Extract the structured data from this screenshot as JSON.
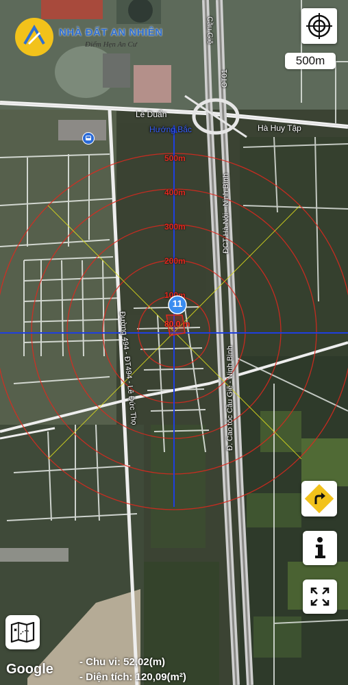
{
  "brand": {
    "title": "NHÀ ĐẤT AN NHIÊN",
    "tagline": "Điểm Hẹn An Cư",
    "accent": "#f2c21b",
    "title_color": "#2f6fd0"
  },
  "scale": {
    "label": "500m"
  },
  "direction": {
    "label": "Hướng Bắc"
  },
  "rings": [
    {
      "label": "500m"
    },
    {
      "label": "400m"
    },
    {
      "label": "300m"
    },
    {
      "label": "200m"
    },
    {
      "label": "100m"
    }
  ],
  "marker": {
    "number": "11",
    "distance": "80.0 m"
  },
  "roads": {
    "le_duan": "Lê Duẩn",
    "ha_huy_tap": "Hà Huy Tập",
    "cau_gie": "Cầu Giẽ",
    "ct01": "CT01",
    "dct": "ĐCT Hà Nội - Ninh Bình",
    "d_cao_toc": "Đ. Cao tốc Cầu Giẽ - Ninh Bình",
    "duong_494": "Đường 494 - ĐT494 - Lê Đức Thọ"
  },
  "stats": {
    "perimeter": "- Chu vi: 52,02(m)",
    "area": "- Diện tích: 120,09(m²)"
  },
  "attribution": "Google",
  "icons": {
    "locate": "crosshair-icon",
    "directions": "turn-right-icon",
    "info": "info-icon",
    "fullscreen": "expand-icon",
    "map_layers": "map-icon",
    "bus": "bus-stop-icon"
  },
  "colors": {
    "ring": "#e0281e",
    "axis": "#1f3fe0",
    "diag": "#d8d81e",
    "marker": "#3a8df0"
  }
}
